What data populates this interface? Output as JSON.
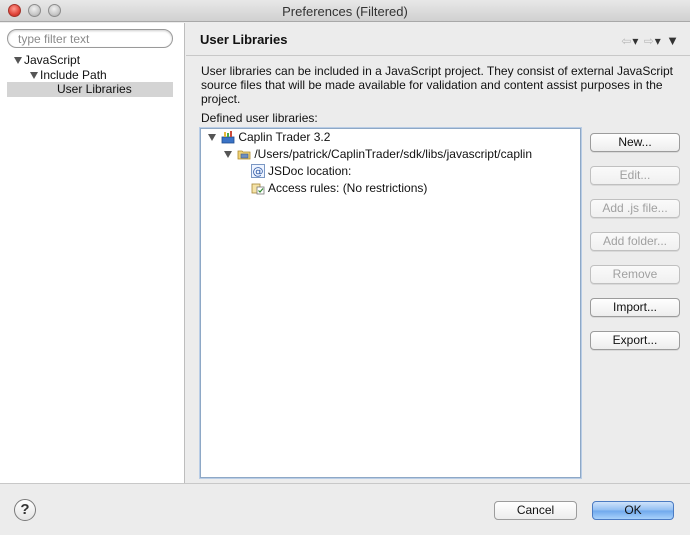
{
  "window": {
    "title": "Preferences (Filtered)"
  },
  "left_pane": {
    "filter_placeholder": "type filter text",
    "tree": [
      {
        "label": "JavaScript",
        "expanded": true
      },
      {
        "label": "Include Path",
        "expanded": true
      },
      {
        "label": "User Libraries",
        "selected": true
      }
    ]
  },
  "right_pane": {
    "title": "User Libraries",
    "description": "User libraries can be included in a JavaScript project. They consist of external JavaScript source files that will be made available for validation and content assist purposes in the project.",
    "defined_label": "Defined user libraries:",
    "libraries": [
      {
        "label": "Caplin Trader 3.2",
        "icon": "library-icon"
      },
      {
        "label": "/Users/patrick/CaplinTrader/sdk/libs/javascript/caplin",
        "icon": "folder-library-icon"
      },
      {
        "label": "JSDoc location:",
        "icon": "jsdoc-icon"
      },
      {
        "label": "Access rules: (No restrictions)",
        "icon": "access-rules-icon"
      }
    ],
    "buttons": {
      "new": "New...",
      "edit": "Edit...",
      "add_js": "Add .js file...",
      "add_folder": "Add folder...",
      "remove": "Remove",
      "import": "Import...",
      "export": "Export..."
    }
  },
  "bottom_bar": {
    "help": "?",
    "cancel": "Cancel",
    "ok": "OK"
  },
  "colors": {
    "ok_accent": "#6ea8ec",
    "selection": "#d4d4d4",
    "list_border": "#8ea8c6"
  }
}
